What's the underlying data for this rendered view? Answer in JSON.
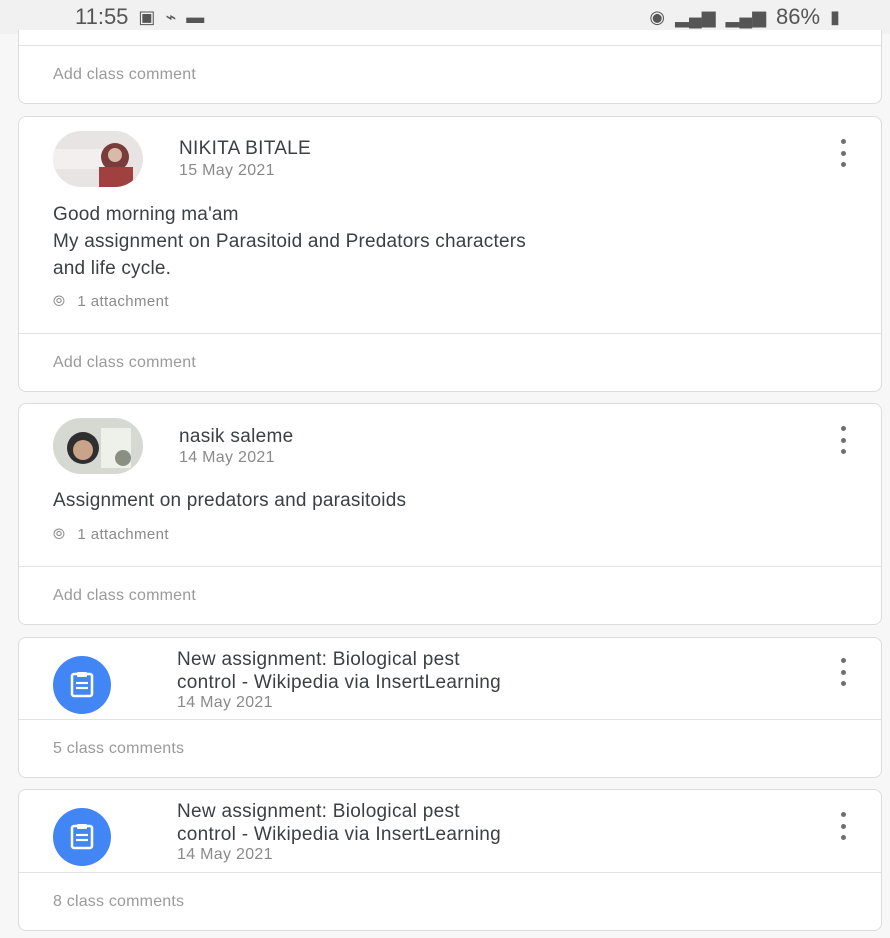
{
  "status_bar": {
    "time": "11:55",
    "battery": "86%"
  },
  "posts": [
    {
      "comment_label": "Add class comment"
    },
    {
      "author": "NIKITA BITALE",
      "date": "15 May 2021",
      "body_lines": [
        "Good morning ma'am",
        "My assignment on Parasitoid and Predators characters",
        "and life cycle."
      ],
      "attachments": "1 attachment",
      "comment_label": "Add class comment"
    },
    {
      "author": "nasik saleme",
      "date": "14 May 2021",
      "body_lines": [
        "Assignment on predators and parasitoids"
      ],
      "attachments": "1 attachment",
      "comment_label": "Add class comment"
    }
  ],
  "assignments": [
    {
      "title_lines": [
        "New assignment: Biological pest",
        "control - Wikipedia via InsertLearning"
      ],
      "date": "14 May 2021",
      "comments": "5 class comments"
    },
    {
      "title_lines": [
        "New assignment: Biological pest",
        "control - Wikipedia via InsertLearning"
      ],
      "date": "14 May 2021",
      "comments": "8 class comments"
    }
  ],
  "colors": {
    "assignment_icon_bg": "#4285f4",
    "card_border": "#dcdcdc"
  },
  "icons": {
    "more": "kebab-menu-icon",
    "assignment": "assignment-clipboard-icon",
    "attachment": "paperclip-icon"
  }
}
